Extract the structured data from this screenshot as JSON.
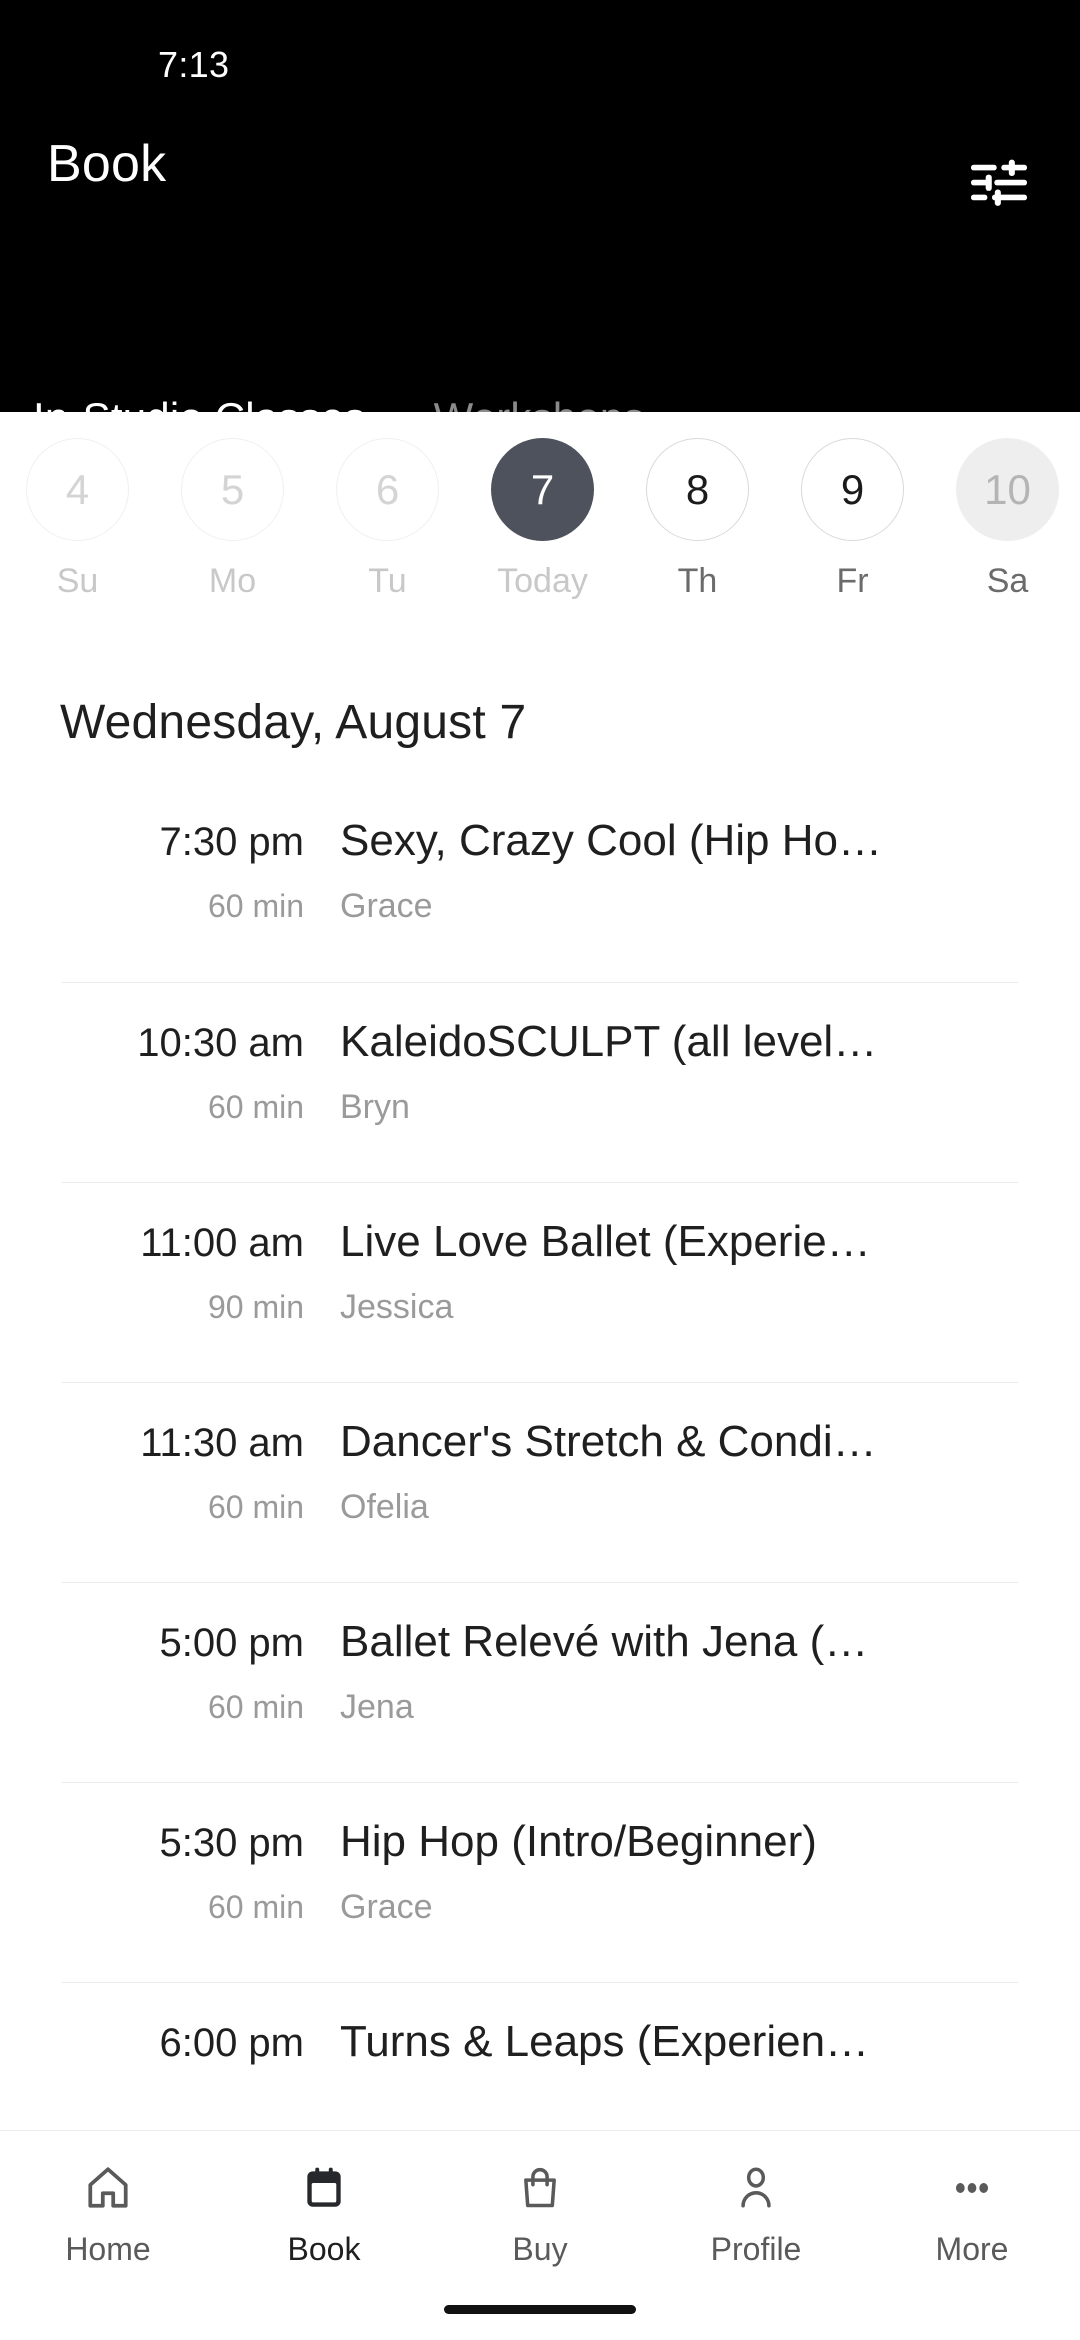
{
  "status_bar": {
    "time": "7:13"
  },
  "appbar": {
    "title": "Book",
    "filter_icon": "tune-sliders-icon"
  },
  "tabs": [
    {
      "label": "In-Studio Classes",
      "active": true
    },
    {
      "label": "Workshops",
      "active": false
    }
  ],
  "date_strip": {
    "days": [
      {
        "num": "4",
        "weekday": "Su",
        "state": "past"
      },
      {
        "num": "5",
        "weekday": "Mo",
        "state": "past"
      },
      {
        "num": "6",
        "weekday": "Tu",
        "state": "past"
      },
      {
        "num": "7",
        "weekday": "Today",
        "state": "today"
      },
      {
        "num": "8",
        "weekday": "Th",
        "state": "available"
      },
      {
        "num": "9",
        "weekday": "Fr",
        "state": "available"
      },
      {
        "num": "10",
        "weekday": "Sa",
        "state": "dim"
      }
    ]
  },
  "date_heading": "Wednesday, August 7",
  "classes": [
    {
      "time": "7:30 pm",
      "duration": "60 min",
      "title": "Sexy, Crazy Cool (Hip Ho…",
      "teacher": "Grace"
    },
    {
      "time": "10:30 am",
      "duration": "60 min",
      "title": "KaleidoSCULPT (all level…",
      "teacher": "Bryn"
    },
    {
      "time": "11:00 am",
      "duration": "90 min",
      "title": "Live Love Ballet (Experie…",
      "teacher": "Jessica"
    },
    {
      "time": "11:30 am",
      "duration": "60 min",
      "title": "Dancer's Stretch & Condi…",
      "teacher": "Ofelia"
    },
    {
      "time": "5:00 pm",
      "duration": "60 min",
      "title": "Ballet Relevé with Jena (…",
      "teacher": "Jena"
    },
    {
      "time": "5:30 pm",
      "duration": "60 min",
      "title": "Hip Hop (Intro/Beginner)",
      "teacher": "Grace"
    },
    {
      "time": "6:00 pm",
      "duration": "",
      "title": "Turns & Leaps (Experien…",
      "teacher": ""
    }
  ],
  "bottom_nav": [
    {
      "label": "Home",
      "icon": "home-icon",
      "active": false
    },
    {
      "label": "Book",
      "icon": "calendar-icon",
      "active": true
    },
    {
      "label": "Buy",
      "icon": "shopping-bag-icon",
      "active": false
    },
    {
      "label": "Profile",
      "icon": "person-icon",
      "active": false
    },
    {
      "label": "More",
      "icon": "ellipsis-icon",
      "active": false
    }
  ],
  "colors": {
    "header_bg": "#000000",
    "selected_day": "#4d525c",
    "muted_text": "#9a9a9a",
    "primary_text": "#1f1f1f"
  }
}
